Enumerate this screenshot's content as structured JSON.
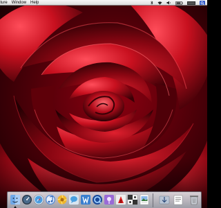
{
  "menubar": {
    "items": [
      "pture",
      "Window",
      "Help"
    ],
    "status_icons": [
      "bluetooth-icon",
      "airport-icon",
      "volume-icon",
      "battery-icon",
      "clock-icon",
      "spotlight-icon"
    ]
  },
  "wallpaper": {
    "subject": "red rose close-up",
    "colors": {
      "dark": "#1a0004",
      "deep": "#4a0008",
      "mid": "#8c0010",
      "bright": "#d8162a",
      "highlight": "#ff5a64"
    }
  },
  "dock": {
    "apps": [
      {
        "name": "finder-icon",
        "running": true
      },
      {
        "name": "dashboard-icon",
        "running": false
      },
      {
        "name": "safari-icon",
        "running": false
      },
      {
        "name": "itunes-icon",
        "running": false
      },
      {
        "name": "iphoto-icon",
        "running": false
      },
      {
        "name": "ichat-icon",
        "running": false
      },
      {
        "name": "iweb-icon",
        "running": false
      },
      {
        "name": "quicktime-icon",
        "running": false
      },
      {
        "name": "podcast-capture-icon",
        "running": false
      },
      {
        "name": "garageband-icon",
        "running": false
      },
      {
        "name": "chess-icon",
        "running": false
      },
      {
        "name": "preview-icon",
        "running": false
      }
    ],
    "stack_items": [
      "downloads-stack-icon",
      "documents-stack-icon",
      "trash-icon"
    ]
  }
}
